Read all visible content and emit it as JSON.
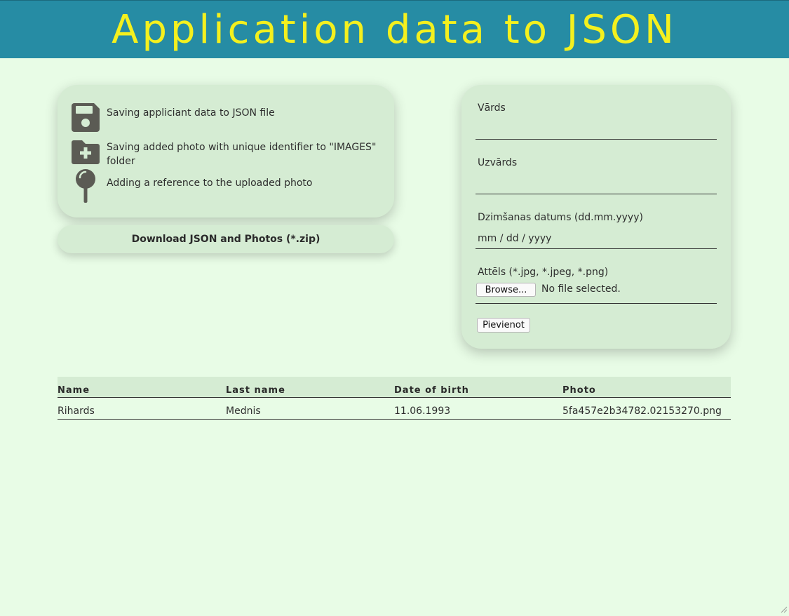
{
  "header": {
    "title": "Application data to JSON"
  },
  "info": {
    "items": [
      {
        "icon": "save-icon",
        "text": "Saving appliciant data to JSON file"
      },
      {
        "icon": "folder-plus-icon",
        "text": "Saving added photo with unique identifier to \"IMAGES\" folder"
      },
      {
        "icon": "map-pin-icon",
        "text": "Adding a reference to the uploaded photo"
      }
    ]
  },
  "download": {
    "label": "Download JSON and Photos (*.zip)"
  },
  "form": {
    "first_name_label": "Vārds",
    "first_name_value": "",
    "last_name_label": "Uzvārds",
    "last_name_value": "",
    "dob_label": "Dzimšanas datums (dd.mm.yyyy)",
    "dob_placeholder": "mm / dd / yyyy",
    "photo_label": "Attēls (*.jpg, *.jpeg, *.png)",
    "browse_label": "Browse...",
    "no_file_label": "No file selected.",
    "submit_label": "Pievienot"
  },
  "table": {
    "headers": [
      "Name",
      "Last name",
      "Date of birth",
      "Photo"
    ],
    "rows": [
      [
        "Rihards",
        "Mednis",
        "11.06.1993",
        "5fa457e2b34782.02153270.png"
      ]
    ]
  },
  "colors": {
    "background": "#e8fce6",
    "header": "#268ca4",
    "title": "#f4f01e",
    "card": "#d5ecd3",
    "icon": "#5b5b54"
  }
}
